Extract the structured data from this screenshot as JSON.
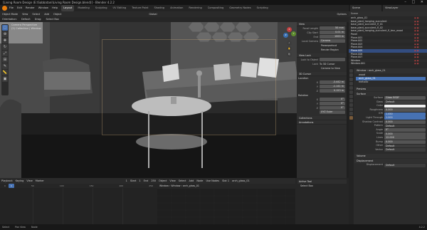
{
  "window": {
    "title": "[Living Room Design (E:\\Sabbatani\\Living Room Design.blend)] - Blender 4.2.2",
    "controls": "– □ ✕"
  },
  "menu": {
    "items": [
      "File",
      "Edit",
      "Render",
      "Window",
      "Help"
    ],
    "workspaces": [
      "Layout",
      "Modeling",
      "Sculpting",
      "UV Editing",
      "Texture Paint",
      "Shading",
      "Animation",
      "Rendering",
      "Compositing",
      "Geometry Nodes",
      "Scripting"
    ],
    "active_workspace": "Layout",
    "scene": "Scene",
    "view_layer": "ViewLayer"
  },
  "viewport_header": {
    "items": [
      "Object Mode",
      "View",
      "Select",
      "Add",
      "Object",
      "Global",
      "Options"
    ],
    "row2": [
      "Orientation:",
      "Default",
      "Drag:",
      "Select Box"
    ]
  },
  "viewport": {
    "camera_label": "Camera Perspective",
    "collection_label": "(2) Collection | Window"
  },
  "npanel": {
    "view_header": "View",
    "focal_length_label": "Focal Length",
    "focal_length": "50 mm",
    "clip_start_label": "Clip Start",
    "clip_start": "0.01 m",
    "clip_end_label": "End",
    "clip_end": "1000 m",
    "local_camera_label": "Local Camera",
    "local_camera": "Camera",
    "passepartout": "Passepartout",
    "render_region": "Render Region",
    "view_lock": "View Lock",
    "lock_to_object": "Lock to Object",
    "lock_label": "Lock",
    "to_3d_cursor": "To 3D Cursor",
    "camera_to_view": "Camera to View",
    "cursor_header": "3D Cursor",
    "location_label": "Location",
    "loc": [
      {
        "k": "X",
        "v": "-3.442 m"
      },
      {
        "k": "Y",
        "v": "-1.141 m"
      },
      {
        "k": "Z",
        "v": "0.153 m"
      }
    ],
    "rotation_label": "Rotation",
    "rot": [
      {
        "k": "X",
        "v": "0°"
      },
      {
        "k": "Y",
        "v": "0°"
      },
      {
        "k": "Z",
        "v": "0°"
      }
    ],
    "rotation_mode": "XYZ Euler",
    "collections": "Collections",
    "annotations": "Annotations"
  },
  "timeline": {
    "items": [
      "Playback",
      "Keying",
      "View",
      "Marker"
    ],
    "frame": "1",
    "start_label": "Start",
    "start": "1",
    "end_label": "End",
    "end": "250",
    "ruler": [
      "0",
      "50",
      "100",
      "150",
      "200",
      "250"
    ]
  },
  "node_editor": {
    "items": [
      "Object",
      "View",
      "Select",
      "Add",
      "Node",
      "Use Nodes",
      "Slot 1",
      "arch_glass_01"
    ],
    "path": "Window  ›  Window  ›  arch_glass_01"
  },
  "active_tool": {
    "header": "Active Tool",
    "tool": "Select Box"
  },
  "outliner": {
    "header": "Scene",
    "rows": [
      {
        "name": "arch_glass_01",
        "sel": false
      },
      {
        "name": "base_plant_hanging_succulent",
        "sel": false
      },
      {
        "name": "base_plant_succulent_fl_01",
        "sel": false
      },
      {
        "name": "base_plant_succulent_fl_02",
        "sel": false
      },
      {
        "name": "base_plant_hanging_succulent_fl_texr_wood",
        "sel": false
      },
      {
        "name": "Panel",
        "sel": false
      },
      {
        "name": "Plane.001",
        "sel": false
      },
      {
        "name": "Plane.002",
        "sel": false
      },
      {
        "name": "Plane.003",
        "sel": false
      },
      {
        "name": "Plane.004",
        "sel": false
      },
      {
        "name": "Plane.005",
        "sel": true
      },
      {
        "name": "Plane.006",
        "sel": false
      },
      {
        "name": "Plane.007",
        "sel": false
      },
      {
        "name": "Window",
        "sel": false
      },
      {
        "name": "Window.001",
        "sel": false
      }
    ]
  },
  "properties": {
    "object_label": "Window",
    "material_label": "arch_glass_01",
    "slots": [
      {
        "name": "wood",
        "sel": false
      },
      {
        "name": "arch_glass_01",
        "sel": true
      },
      {
        "name": "metallic",
        "sel": false
      }
    ],
    "preview": "Preview",
    "surface_header": "Surface",
    "surface_label": "Surface",
    "surface": "Glass BSDF",
    "rows": [
      {
        "k": "Glass",
        "v": "Default",
        "c": "dark"
      },
      {
        "k": "Color",
        "v": "",
        "c": "white"
      },
      {
        "k": "Roughness",
        "v": "0.000",
        "c": ""
      },
      {
        "k": "IOR",
        "v": "1.450",
        "c": ""
      },
      {
        "k": "Light Through",
        "v": "1.000",
        "c": ""
      },
      {
        "k": "Shadow Contrast",
        "v": "0.000",
        "c": ""
      },
      {
        "k": "Pattern",
        "v": "Default",
        "c": "dark"
      },
      {
        "k": "Angle",
        "v": "0°",
        "c": ""
      },
      {
        "k": "Scale",
        "v": "5.000",
        "c": ""
      },
      {
        "k": "Lines",
        "v": "12.000",
        "c": ""
      },
      {
        "k": "Bump",
        "v": "0.000",
        "c": ""
      },
      {
        "k": "Other",
        "v": "Default",
        "c": "dark"
      },
      {
        "k": "Vector",
        "v": "Default",
        "c": "dark"
      }
    ],
    "volume": "Volume",
    "displacement": "Displacement",
    "displacement_label": "Displacement",
    "displacement_value": "Default"
  },
  "statusbar": {
    "items": [
      "Select",
      "Pan View",
      "Node"
    ],
    "version": "4.2.2"
  }
}
